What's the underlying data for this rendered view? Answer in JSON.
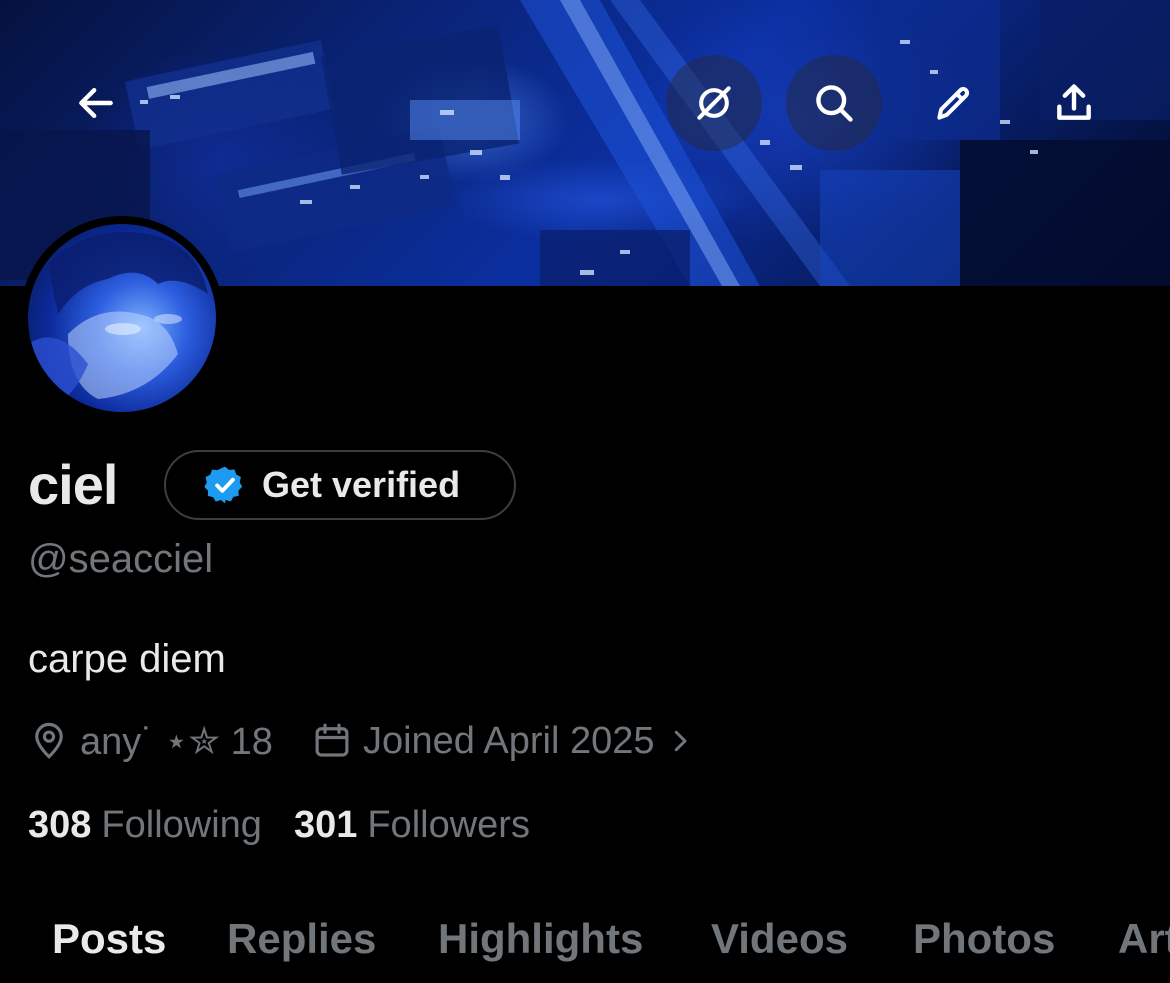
{
  "profile": {
    "name": "ciel",
    "handle": "@seacciel",
    "bio": "carpe diem",
    "location": "any˙ ⋆✮ 18",
    "joined": "Joined April 2025",
    "following_count": "308",
    "following_label": "Following",
    "followers_count": "301",
    "followers_label": "Followers"
  },
  "verify": {
    "label": "Get verified"
  },
  "toolbar": {
    "icons": [
      "back-arrow-icon",
      "grok-icon",
      "search-icon",
      "pencil-icon",
      "share-icon"
    ]
  },
  "tabs": [
    "Posts",
    "Replies",
    "Highlights",
    "Videos",
    "Photos",
    "Articles"
  ],
  "colors": {
    "background": "#000000",
    "text_primary": "#e7e9ea",
    "text_secondary": "#71767b",
    "verify_badge": "#1d9bf0",
    "border": "#3b3f44"
  }
}
